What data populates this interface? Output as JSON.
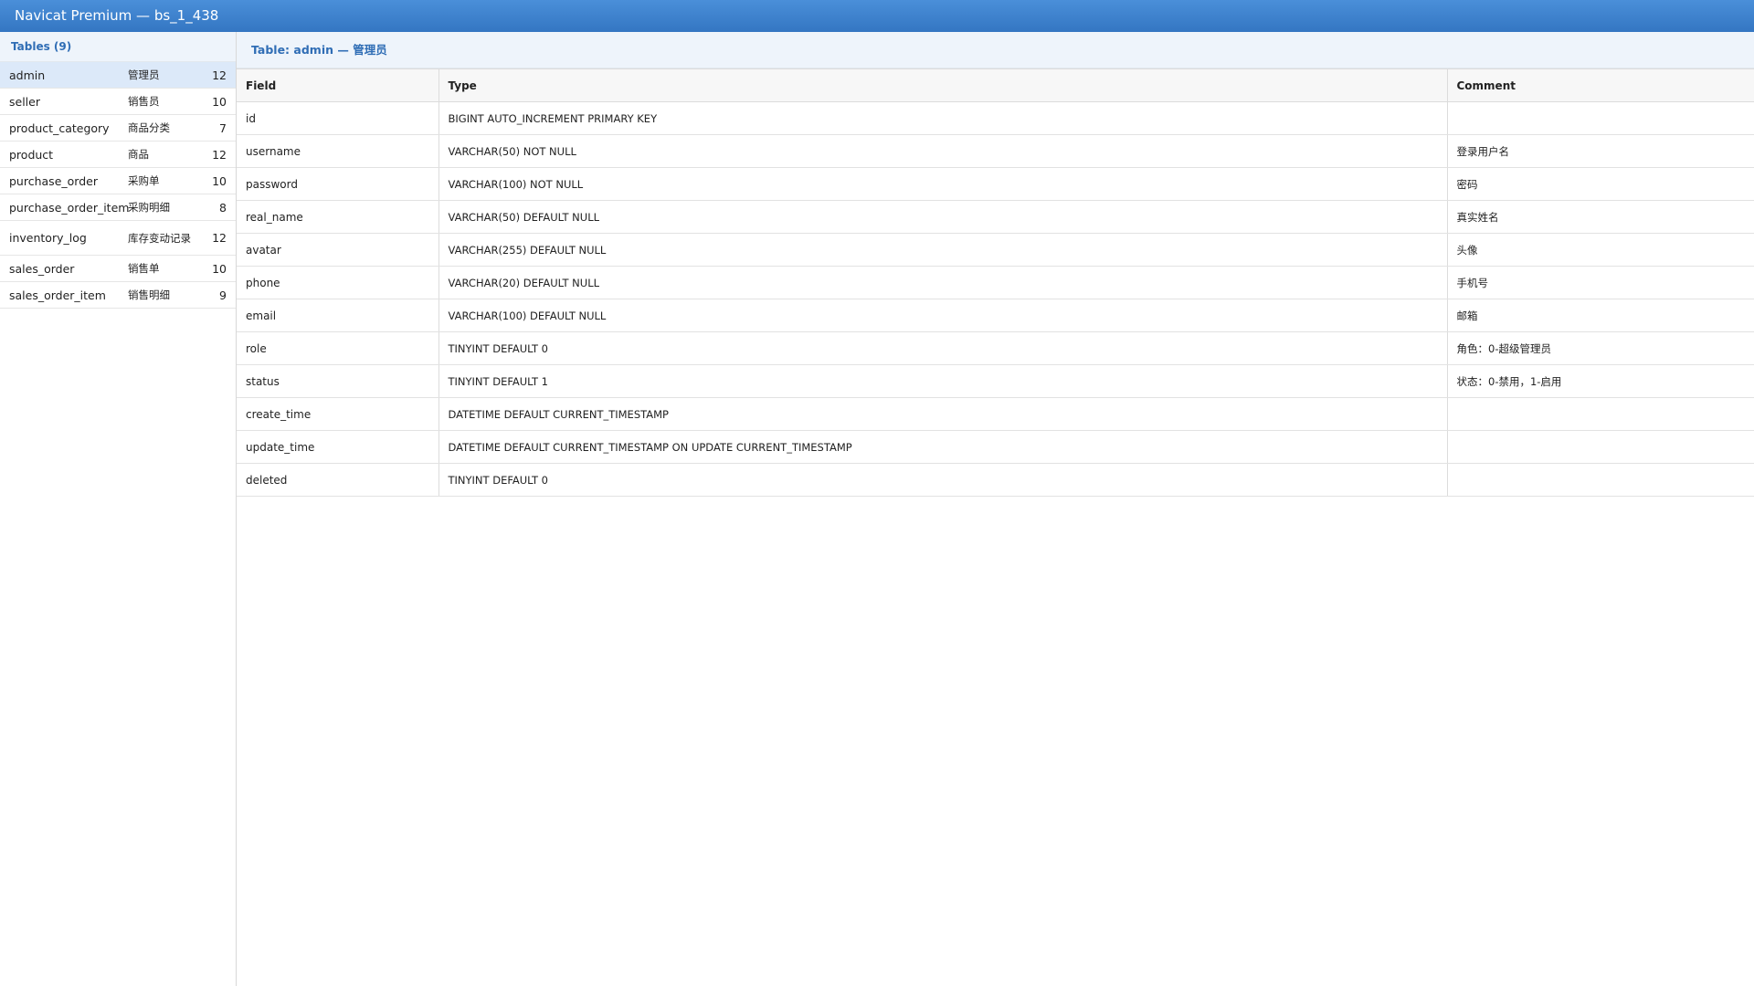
{
  "window": {
    "title": "Navicat Premium — bs_1_438"
  },
  "sidebar": {
    "header": "Tables (9)",
    "tables": [
      {
        "name": "admin",
        "comment": "管理员",
        "count": "12"
      },
      {
        "name": "seller",
        "comment": "销售员",
        "count": "10"
      },
      {
        "name": "product_category",
        "comment": "商品分类",
        "count": "7"
      },
      {
        "name": "product",
        "comment": "商品",
        "count": "12"
      },
      {
        "name": "purchase_order",
        "comment": "采购单",
        "count": "10"
      },
      {
        "name": "purchase_order_item",
        "comment": "采购明细",
        "count": "8"
      },
      {
        "name": "inventory_log",
        "comment": "库存变动记录",
        "count": "12"
      },
      {
        "name": "sales_order",
        "comment": "销售单",
        "count": "10"
      },
      {
        "name": "sales_order_item",
        "comment": "销售明细",
        "count": "9"
      }
    ],
    "selected": "admin"
  },
  "main": {
    "header": "Table: admin — 管理员",
    "columns": [
      "Field",
      "Type",
      "Comment"
    ],
    "rows": [
      {
        "field": "id",
        "type": "BIGINT AUTO_INCREMENT PRIMARY KEY",
        "comment": ""
      },
      {
        "field": "username",
        "type": "VARCHAR(50) NOT NULL",
        "comment": "登录用户名"
      },
      {
        "field": "password",
        "type": "VARCHAR(100) NOT NULL",
        "comment": "密码"
      },
      {
        "field": "real_name",
        "type": "VARCHAR(50) DEFAULT NULL",
        "comment": "真实姓名"
      },
      {
        "field": "avatar",
        "type": "VARCHAR(255) DEFAULT NULL",
        "comment": "头像"
      },
      {
        "field": "phone",
        "type": "VARCHAR(20) DEFAULT NULL",
        "comment": "手机号"
      },
      {
        "field": "email",
        "type": "VARCHAR(100) DEFAULT NULL",
        "comment": "邮箱"
      },
      {
        "field": "role",
        "type": "TINYINT DEFAULT 0",
        "comment": "角色：0-超级管理员"
      },
      {
        "field": "status",
        "type": "TINYINT DEFAULT 1",
        "comment": "状态：0-禁用，1-启用"
      },
      {
        "field": "create_time",
        "type": "DATETIME DEFAULT CURRENT_TIMESTAMP",
        "comment": ""
      },
      {
        "field": "update_time",
        "type": "DATETIME DEFAULT CURRENT_TIMESTAMP ON UPDATE CURRENT_TIMESTAMP",
        "comment": ""
      },
      {
        "field": "deleted",
        "type": "TINYINT DEFAULT 0",
        "comment": ""
      }
    ]
  },
  "colors": {
    "titlebar": "#3a80cc",
    "accent": "#2f6db5",
    "selected_row": "#dce9f9",
    "header_bg": "#eef4fb"
  }
}
